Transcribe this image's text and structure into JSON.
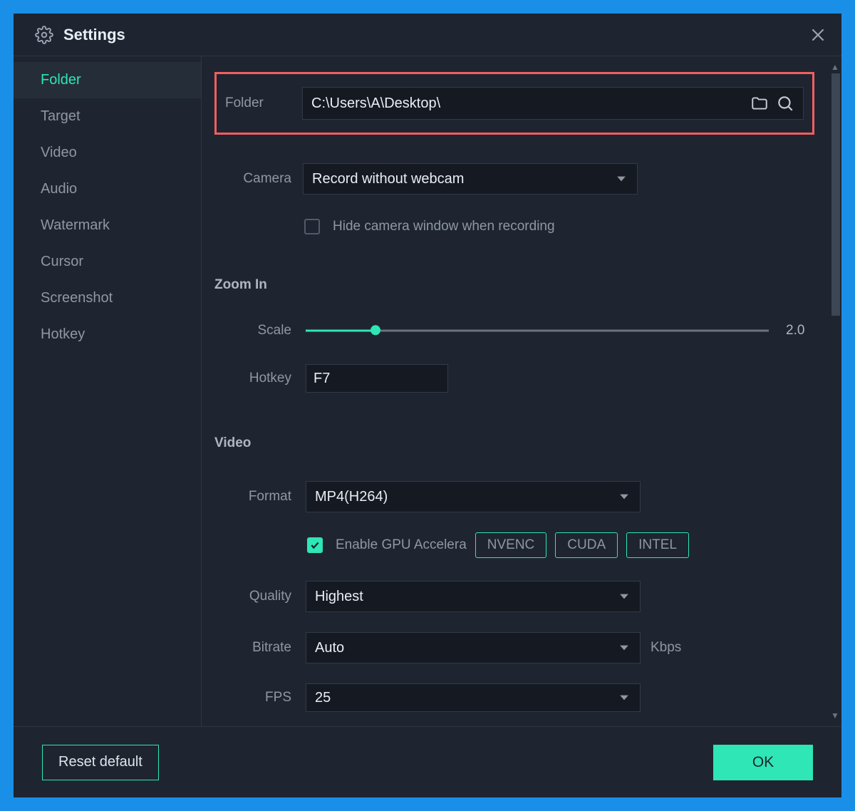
{
  "window": {
    "title": "Settings"
  },
  "sidebar": {
    "items": [
      "Folder",
      "Target",
      "Video",
      "Audio",
      "Watermark",
      "Cursor",
      "Screenshot",
      "Hotkey"
    ],
    "active": 0
  },
  "folder": {
    "label": "Folder",
    "path": "C:\\Users\\A\\Desktop\\"
  },
  "camera": {
    "label": "Camera",
    "value": "Record without webcam",
    "hide_checkbox_label": "Hide camera window when recording",
    "hide_checked": false
  },
  "zoom": {
    "heading": "Zoom In",
    "scale_label": "Scale",
    "scale_value": "2.0",
    "hotkey_label": "Hotkey",
    "hotkey_value": "F7"
  },
  "video": {
    "heading": "Video",
    "format_label": "Format",
    "format_value": "MP4(H264)",
    "gpu_label": "Enable GPU Accelera",
    "gpu_checked": true,
    "gpu_options": [
      "NVENC",
      "CUDA",
      "INTEL"
    ],
    "quality_label": "Quality",
    "quality_value": "Highest",
    "bitrate_label": "Bitrate",
    "bitrate_value": "Auto",
    "bitrate_unit": "Kbps",
    "fps_label": "FPS",
    "fps_value": "25"
  },
  "footer": {
    "reset": "Reset default",
    "ok": "OK"
  }
}
